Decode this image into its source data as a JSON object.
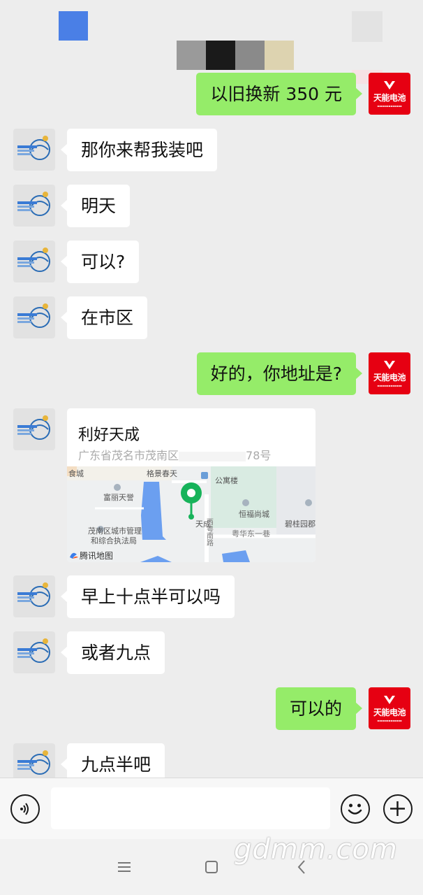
{
  "colors": {
    "background": "#ededed",
    "bubble_sent": "#95ec69",
    "bubble_received": "#ffffff",
    "brand_red": "#e60012"
  },
  "self_avatar": {
    "brand": "天能电池"
  },
  "messages": [
    {
      "side": "right",
      "text": "以旧换新 350 元"
    },
    {
      "side": "left",
      "text": "那你来帮我装吧"
    },
    {
      "side": "left",
      "text": "明天"
    },
    {
      "side": "left",
      "text": "可以?"
    },
    {
      "side": "left",
      "text": "在市区"
    },
    {
      "side": "right",
      "text": "好的，你地址是?"
    },
    {
      "side": "left",
      "text": "早上十点半可以吗"
    },
    {
      "side": "left",
      "text": "或者九点"
    },
    {
      "side": "right",
      "text": "可以的"
    },
    {
      "side": "left",
      "text": "九点半吧"
    }
  ],
  "location": {
    "name": "利好天成",
    "address_prefix": "广东省茂名市茂南区",
    "address_suffix": "78号",
    "map_provider": "腾讯地图",
    "map_labels": {
      "top_left": "食城",
      "jingjing": "格景春天",
      "gongyu": "公寓楼",
      "fuli": "富丽天誉",
      "hengfu": "恒福尚城",
      "bigui": "碧桂园郡",
      "chengguan1": "茂南区城市管理",
      "chengguan2": "和综合执法局",
      "tiancheng": "天成",
      "road_vertical": "西粤南路",
      "road_east": "粤华东一巷"
    }
  },
  "input": {
    "placeholder": ""
  },
  "watermark": "gdmm.com",
  "icons": {
    "voice": "voice-icon",
    "emoji": "emoji-icon",
    "plus": "plus-icon",
    "menu": "menu-icon",
    "home": "home-icon",
    "back": "back-icon"
  }
}
